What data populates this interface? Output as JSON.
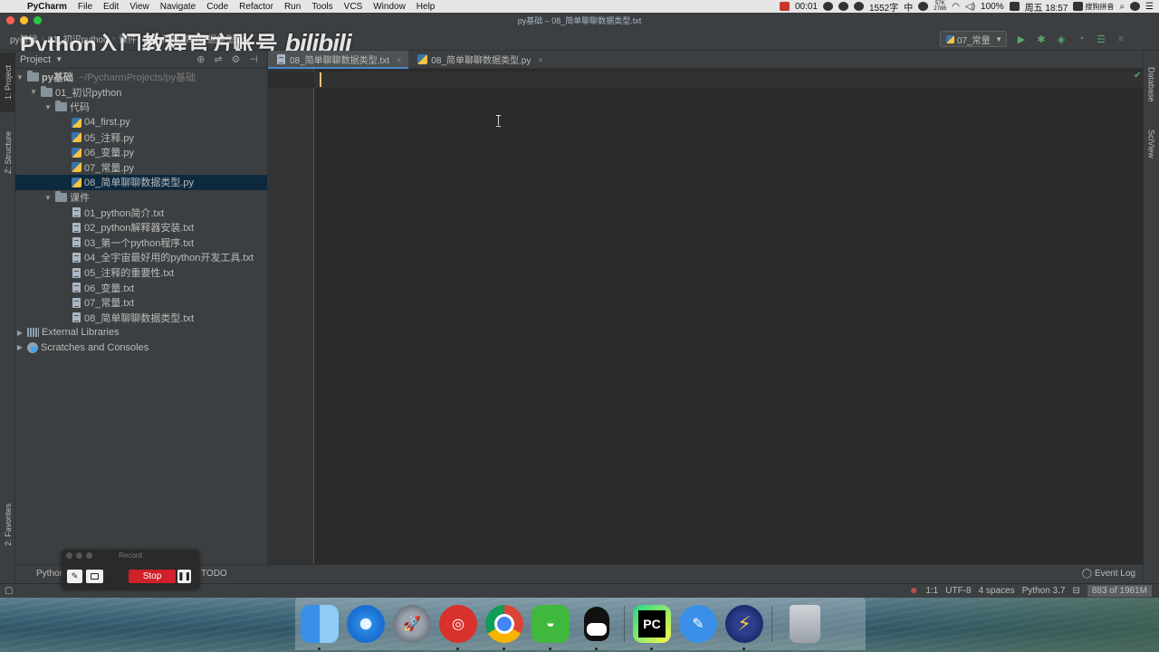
{
  "menubar": {
    "app_name": "PyCharm",
    "menus": [
      "File",
      "Edit",
      "View",
      "Navigate",
      "Code",
      "Refactor",
      "Run",
      "Tools",
      "VCS",
      "Window",
      "Help"
    ],
    "timer": "00:01",
    "word_count": "1552字",
    "ime_char": "中",
    "net_up": "57K",
    "net_down": "278B",
    "battery": "100%",
    "clock": "周五 18:57",
    "input_method": "搜狗拼音"
  },
  "window": {
    "title": "py基础 – 08_简单聊聊数据类型.txt"
  },
  "breadcrumb": [
    "py基础",
    "01_初识python",
    "课件",
    "08_简单聊聊数据类型.txt"
  ],
  "watermark": {
    "text": "Python入门教程官方账号",
    "logo": "bilibili"
  },
  "run_config": {
    "selected": "07_常量"
  },
  "left_tools": {
    "project": "1: Project",
    "structure": "Z: Structure",
    "favorites": "2: Favorites"
  },
  "right_tools": {
    "database": "Database",
    "sciview": "SciView"
  },
  "project_panel": {
    "title": "Project",
    "root": {
      "name": "py基础",
      "path": "~/PycharmProjects/py基础"
    },
    "folder_01": "01_初识python",
    "folder_code": "代码",
    "code_files": [
      "04_first.py",
      "05_注释.py",
      "06_变量.py",
      "07_常量.py",
      "08_简单聊聊数据类型.py"
    ],
    "folder_courseware": "课件",
    "courseware_files": [
      "01_python简介.txt",
      "02_python解释器安装.txt",
      "03_第一个python程序.txt",
      "04_全宇宙最好用的python开发工具.txt",
      "05_注释的重要性.txt",
      "06_变量.txt",
      "07_常量.txt",
      "08_简单聊聊数据类型.txt"
    ],
    "external_libraries": "External Libraries",
    "scratches": "Scratches and Consoles"
  },
  "editor_tabs": [
    {
      "label": "08_简单聊聊数据类型.txt",
      "active": true
    },
    {
      "label": "08_简单聊聊数据类型.py",
      "active": false
    }
  ],
  "bottom_tools": {
    "python_console": "Python",
    "todo": "TODO",
    "event_log": "Event Log"
  },
  "recorder": {
    "title": "Record",
    "stop": "Stop"
  },
  "statusbar": {
    "position": "1:1",
    "encoding": "UTF-8",
    "indent": "4 spaces",
    "interpreter": "Python 3.7",
    "memory": "883 of 1981M"
  }
}
